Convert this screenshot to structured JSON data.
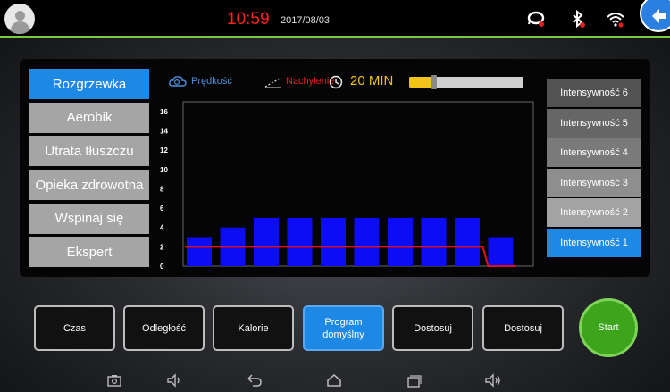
{
  "status_bar": {
    "time": "10:59",
    "date": "2017/08/03"
  },
  "programs": [
    {
      "label": "Rozgrzewka",
      "active": true
    },
    {
      "label": "Aerobik",
      "active": false
    },
    {
      "label": "Utrata tłuszczu",
      "active": false
    },
    {
      "label": "Opieka zdrowotna",
      "active": false
    },
    {
      "label": "Wspinaj się",
      "active": false
    },
    {
      "label": "Ekspert",
      "active": false
    }
  ],
  "chart_header": {
    "speed_label": "Prędkość",
    "incline_label": "Nachylenie",
    "time_label": "20 MIN",
    "time_slider_fraction": 0.22
  },
  "chart_data": {
    "type": "bar",
    "title": "",
    "xlabel": "",
    "ylabel": "",
    "ylim": [
      0,
      17
    ],
    "yticks": [
      "0",
      "2",
      "4",
      "6",
      "8",
      "10",
      "12",
      "14",
      "16"
    ],
    "series": [
      {
        "values": [
          3,
          4,
          5,
          5,
          5,
          5,
          5,
          5,
          5,
          3
        ],
        "color": "#0d0df5"
      },
      {
        "values": [
          2,
          2,
          2,
          2,
          2,
          2,
          2,
          2,
          2,
          0
        ],
        "color": "#e01010",
        "style": "step-line"
      }
    ]
  },
  "intensity_levels": [
    {
      "label": "Intensywność 6",
      "color": "#525252",
      "active": false
    },
    {
      "label": "Intensywność 5",
      "color": "#666666",
      "active": false
    },
    {
      "label": "Intensywność 4",
      "color": "#7a7a7a",
      "active": false
    },
    {
      "label": "Intensywność 3",
      "color": "#8e8e8e",
      "active": false
    },
    {
      "label": "Intensywność 2",
      "color": "#a3a3a3",
      "active": false
    },
    {
      "label": "Intensywność 1",
      "color": "#1e88e5",
      "active": true
    }
  ],
  "buttons": {
    "time": "Czas",
    "distance": "Odległość",
    "calories": "Kalorie",
    "default_program": "Program domyślny",
    "custom1": "Dostosuj",
    "custom2": "Dostosuj",
    "start": "Start"
  },
  "colors": {
    "accent": "#1e88e5",
    "start": "#3ca51c",
    "clock": "#ff2020",
    "time": "#f0c419"
  }
}
